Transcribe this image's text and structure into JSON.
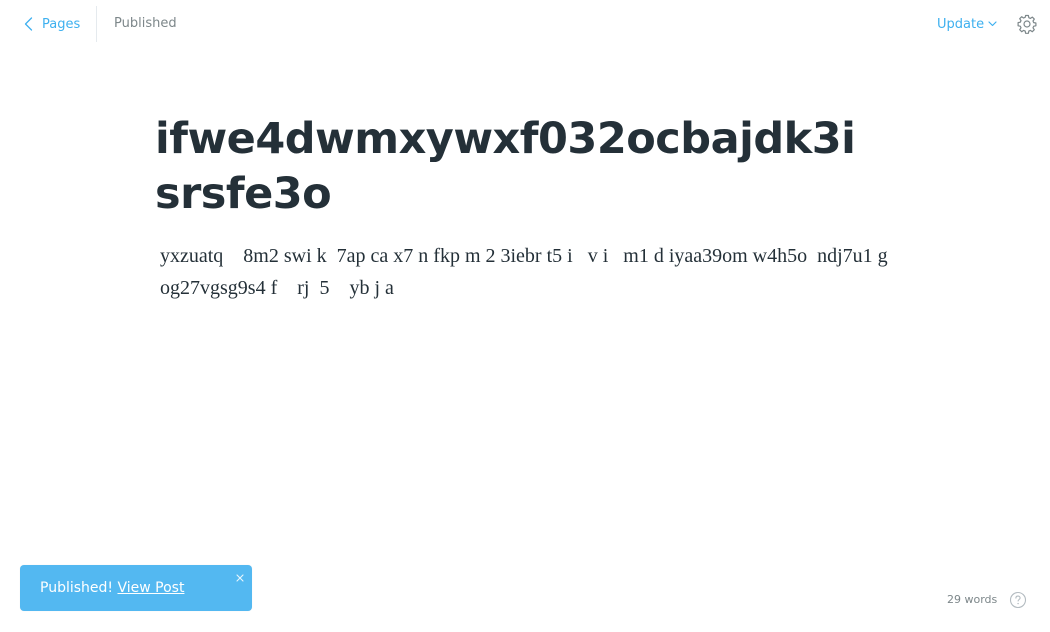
{
  "header": {
    "back_label": "Pages",
    "status": "Published",
    "update_label": "Update"
  },
  "post": {
    "title": "ifwe4dwmxywxf032ocbajdk3isrsfe3o",
    "body": "yxzuatq    8m2 swi k  7ap ca x7 n fkp m 2 3iebr t5 i   v i   m1 d iyaa39om w4h5o  ndj7u1 g  og27vgsg9s4 f    rj  5    yb j a"
  },
  "toast": {
    "message": "Published!",
    "link_label": "View Post"
  },
  "footer": {
    "word_count": "29 words"
  },
  "icons": {
    "back": "chevron-left-icon",
    "update_caret": "chevron-down-icon",
    "settings": "gear-icon",
    "close": "close-icon",
    "help": "help-circle-icon"
  },
  "colors": {
    "accent": "#3eb0ef",
    "toast_bg": "#53b8f1",
    "muted": "#7d878a",
    "text": "#243038"
  }
}
